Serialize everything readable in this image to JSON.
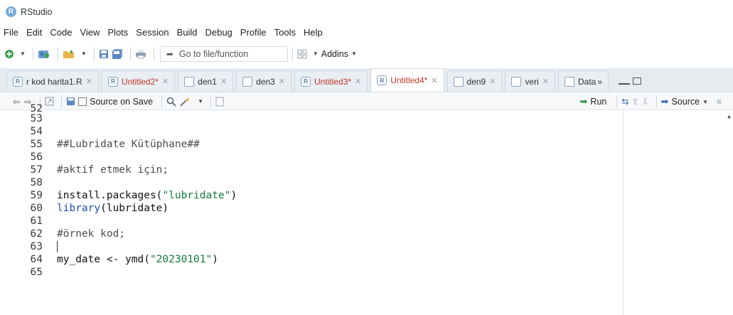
{
  "window": {
    "title": "RStudio",
    "icon": "R"
  },
  "menu": [
    "File",
    "Edit",
    "Code",
    "View",
    "Plots",
    "Session",
    "Build",
    "Debug",
    "Profile",
    "Tools",
    "Help"
  ],
  "toolbar": {
    "goto_placeholder": "Go to file/function",
    "addins_label": "Addins"
  },
  "tabs": [
    {
      "label": "r kod harita1.R",
      "modified": false,
      "kind": "r"
    },
    {
      "label": "Untitled2*",
      "modified": true,
      "kind": "r"
    },
    {
      "label": "den1",
      "modified": false,
      "kind": "data"
    },
    {
      "label": "den3",
      "modified": false,
      "kind": "data"
    },
    {
      "label": "Untitled3*",
      "modified": true,
      "kind": "r"
    },
    {
      "label": "Untitled4*",
      "modified": true,
      "kind": "r",
      "active": true
    },
    {
      "label": "den9",
      "modified": false,
      "kind": "data"
    },
    {
      "label": "veri",
      "modified": false,
      "kind": "data"
    },
    {
      "label": "Data",
      "modified": false,
      "kind": "data"
    }
  ],
  "editor_toolbar": {
    "source_on_save": "Source on Save",
    "run": "Run",
    "source": "Source"
  },
  "editor": {
    "lines": [
      {
        "n": "52",
        "text": ""
      },
      {
        "n": "53",
        "text": ""
      },
      {
        "n": "54",
        "text": ""
      },
      {
        "n": "55",
        "text": "##Lubridate Kütüphane##"
      },
      {
        "n": "56",
        "text": ""
      },
      {
        "n": "57",
        "text": "#aktif etmek için;"
      },
      {
        "n": "58",
        "text": ""
      },
      {
        "n": "59",
        "text": "install.packages(\"lubridate\")"
      },
      {
        "n": "60",
        "text": "library(lubridate)"
      },
      {
        "n": "61",
        "text": ""
      },
      {
        "n": "62",
        "text": "#örnek kod;"
      },
      {
        "n": "63",
        "text": ""
      },
      {
        "n": "64",
        "text": "my_date <- ymd(\"20230101\")"
      },
      {
        "n": "65",
        "text": ""
      }
    ]
  },
  "colors": {
    "tab_modified": "#c0392b",
    "run_arrow": "#2e9a3f",
    "keyword_blue": "#1a4fb3",
    "string_green": "#137a3a"
  }
}
